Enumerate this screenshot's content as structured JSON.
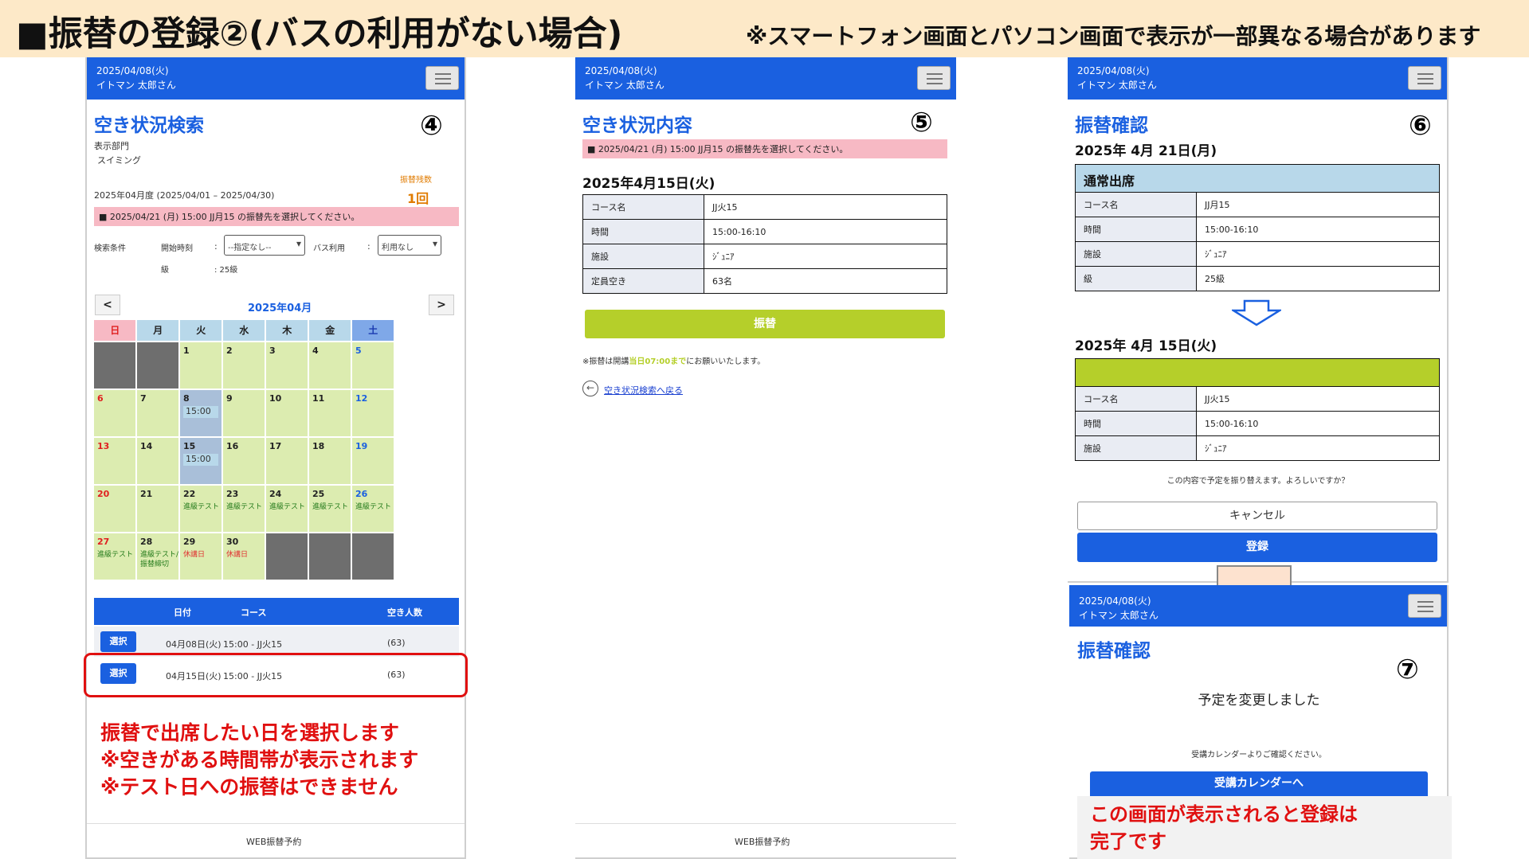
{
  "banner": {
    "title": "■振替の登録②(バスの利用がない場合)",
    "note": "※スマートフォン画面とパソコン画面で表示が一部異なる場合があります"
  },
  "colors": {
    "header_blue": "#1a60e0",
    "calendar_green": "#dcecb0",
    "message_pink": "#f7b9c4",
    "accent_red": "#e01010",
    "button_green": "#b5cf2a",
    "banner_bg": "#fde9c8"
  },
  "icons": {
    "menu": "hamburger-menu-icon",
    "back": "back-arrow-circle-icon",
    "down_arrow": "down-arrow-icon"
  },
  "header": {
    "date": "2025/04/08(火)",
    "user": "イトマン 太郎さん"
  },
  "screen4": {
    "step": "④",
    "title": "空き状況検索",
    "dept_label": "表示部門",
    "dept_value": "スイミング",
    "period": "2025年04月度 (2025/04/01 – 2025/04/30)",
    "remaining_label": "振替残数",
    "remaining_value": "1回",
    "message": "■ 2025/04/21 (月) 15:00 JJ月15 の振替先を選択してください。",
    "filter": {
      "label": "検索条件",
      "start_label": "開始時刻",
      "colon": ":",
      "start_value": "--指定なし--",
      "bus_label": "バス利用",
      "bus_value": "利用なし",
      "grade_label": "級",
      "grade_value": ": 25級"
    },
    "calendar": {
      "prev": "<",
      "next": ">",
      "month": "2025年04月",
      "weekdays": [
        "日",
        "月",
        "火",
        "水",
        "木",
        "金",
        "土"
      ],
      "weekday_colors": [
        "#f7b9c4",
        "#b8d8ea",
        "#b8d8ea",
        "#b8d8ea",
        "#b8d8ea",
        "#b8d8ea",
        "#7fa8e8"
      ],
      "days": [
        {
          "num": "",
          "gray": true
        },
        {
          "num": "",
          "gray": true
        },
        {
          "num": "1"
        },
        {
          "num": "2"
        },
        {
          "num": "3"
        },
        {
          "num": "4"
        },
        {
          "num": "5",
          "sat": true
        },
        {
          "num": "6",
          "sun": true
        },
        {
          "num": "7"
        },
        {
          "num": "8",
          "slot": "15:00"
        },
        {
          "num": "9"
        },
        {
          "num": "10"
        },
        {
          "num": "11"
        },
        {
          "num": "12",
          "sat": true
        },
        {
          "num": "13",
          "sun": true
        },
        {
          "num": "14"
        },
        {
          "num": "15",
          "slot": "15:00"
        },
        {
          "num": "16"
        },
        {
          "num": "17"
        },
        {
          "num": "18"
        },
        {
          "num": "19",
          "sat": true
        },
        {
          "num": "20",
          "sun": true
        },
        {
          "num": "21"
        },
        {
          "num": "22",
          "note": "進級テスト"
        },
        {
          "num": "23",
          "note": "進級テスト"
        },
        {
          "num": "24",
          "note": "進級テスト"
        },
        {
          "num": "25",
          "note": "進級テスト"
        },
        {
          "num": "26",
          "sat": true,
          "note": "進級テスト"
        },
        {
          "num": "27",
          "sun": true,
          "note": "進級テスト"
        },
        {
          "num": "28",
          "note": "進級テスト/\n振替締切"
        },
        {
          "num": "29",
          "note": "休講日",
          "red": true
        },
        {
          "num": "30",
          "note": "休講日",
          "red": true
        },
        {
          "num": "",
          "gray": true
        },
        {
          "num": "",
          "gray": true
        },
        {
          "num": "",
          "gray": true
        }
      ]
    },
    "list": {
      "headers": {
        "date": "日付",
        "course": "コース",
        "vacancy": "空き人数"
      },
      "select_label": "選択",
      "rows": [
        {
          "date": "04月08日(火)",
          "course": "15:00 - JJ火15",
          "vacancy": "(63)"
        },
        {
          "date": "04月15日(火)",
          "course": "15:00 - JJ火15",
          "vacancy": "(63)"
        }
      ]
    },
    "instructions": [
      "振替で出席したい日を選択します",
      "※空きがある時間帯が表示されます",
      "※テスト日への振替はできません"
    ],
    "footer": "WEB振替予約"
  },
  "screen5": {
    "step": "⑤",
    "title": "空き状況内容",
    "message": "■ 2025/04/21 (月) 15:00 JJ月15 の振替先を選択してください。",
    "date": "2025年4月15日(火)",
    "rows": [
      {
        "label": "コース名",
        "value": "JJ火15"
      },
      {
        "label": "時間",
        "value": "15:00-16:10"
      },
      {
        "label": "施設",
        "value": "ｼﾞｭﾆｱ"
      },
      {
        "label": "定員空き",
        "value": "63名"
      }
    ],
    "button": "振替",
    "note_prefix": "※振替は開講",
    "note_highlight": "当日07:00まで",
    "note_suffix": "にお願いいたします。",
    "back_link": "空き状況検索へ戻る",
    "back_glyph": "←",
    "footer": "WEB振替予約"
  },
  "screen6": {
    "step": "⑥",
    "title": "振替確認",
    "from_date": "2025年 4月 21日(月)",
    "from_header": "通常出席",
    "from_rows": [
      {
        "label": "コース名",
        "value": "JJ月15"
      },
      {
        "label": "時間",
        "value": "15:00-16:10"
      },
      {
        "label": "施設",
        "value": "ｼﾞｭﾆｱ"
      },
      {
        "label": "級",
        "value": "25級"
      }
    ],
    "to_date": "2025年 4月 15日(火)",
    "to_rows": [
      {
        "label": "コース名",
        "value": "JJ火15"
      },
      {
        "label": "時間",
        "value": "15:00-16:10"
      },
      {
        "label": "施設",
        "value": "ｼﾞｭﾆｱ"
      }
    ],
    "confirm_text": "この内容で予定を振り替えます。よろしいですか？",
    "cancel": "キャンセル",
    "register": "登録"
  },
  "screen7": {
    "step": "⑦",
    "title": "振替確認",
    "done": "予定を変更しました",
    "sub": "受講カレンダーよりご確認ください。",
    "button": "受講カレンダーへ",
    "note": [
      "この画面が表示されると登録は",
      "完了です"
    ]
  }
}
